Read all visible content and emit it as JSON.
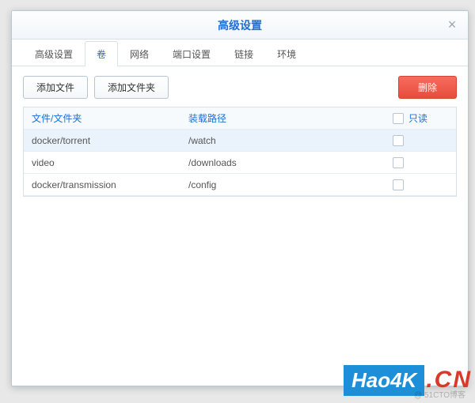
{
  "dialog": {
    "title": "高级设置",
    "close_glyph": "×"
  },
  "tabs": [
    {
      "label": "高级设置",
      "active": false
    },
    {
      "label": "卷",
      "active": true
    },
    {
      "label": "网络",
      "active": false
    },
    {
      "label": "端口设置",
      "active": false
    },
    {
      "label": "链接",
      "active": false
    },
    {
      "label": "环境",
      "active": false
    }
  ],
  "toolbar": {
    "add_file_label": "添加文件",
    "add_folder_label": "添加文件夹",
    "delete_label": "删除"
  },
  "table": {
    "headers": {
      "path": "文件/文件夹",
      "mount": "装载路径",
      "readonly": "只读"
    },
    "rows": [
      {
        "path": "docker/torrent",
        "mount": "/watch",
        "readonly": false,
        "selected": true
      },
      {
        "path": "video",
        "mount": "/downloads",
        "readonly": false,
        "selected": false
      },
      {
        "path": "docker/transmission",
        "mount": "/config",
        "readonly": false,
        "selected": false
      }
    ]
  },
  "watermark": {
    "blue": "Hao4K",
    "red": ".CN",
    "sub": "@ 51CTO博客"
  }
}
